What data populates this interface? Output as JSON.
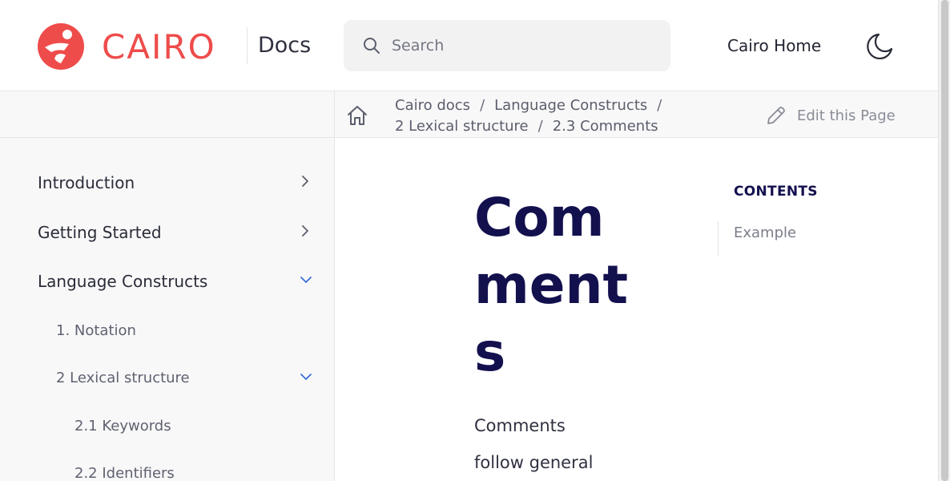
{
  "header": {
    "brand": "CAIRO",
    "docs_label": "Docs",
    "search_placeholder": "Search",
    "home_link": "Cairo Home"
  },
  "breadcrumb": {
    "items": [
      "Cairo docs",
      "Language Constructs",
      "2 Lexical structure",
      "2.3 Comments"
    ],
    "edit_label": "Edit this Page"
  },
  "sidebar": {
    "items": [
      {
        "label": "Introduction",
        "state": "collapsed"
      },
      {
        "label": "Getting Started",
        "state": "collapsed"
      },
      {
        "label": "Language Constructs",
        "state": "expanded"
      },
      {
        "label": "1. Notation"
      },
      {
        "label": "2 Lexical structure",
        "state": "expanded"
      },
      {
        "label": "2.1 Keywords"
      },
      {
        "label": "2.2 Identifiers"
      }
    ]
  },
  "main": {
    "title": "Comments",
    "body": "Comments follow general"
  },
  "toc": {
    "title": "CONTENTS",
    "items": [
      "Example"
    ]
  },
  "colors": {
    "brand": "#ee4c4b",
    "heading": "#13104e",
    "accent_chevron": "#3b6fd8"
  },
  "icons": [
    "cairo-logo-icon",
    "search-icon",
    "moon-icon",
    "home-icon",
    "pencil-icon",
    "chevron-right-icon",
    "chevron-down-icon"
  ]
}
